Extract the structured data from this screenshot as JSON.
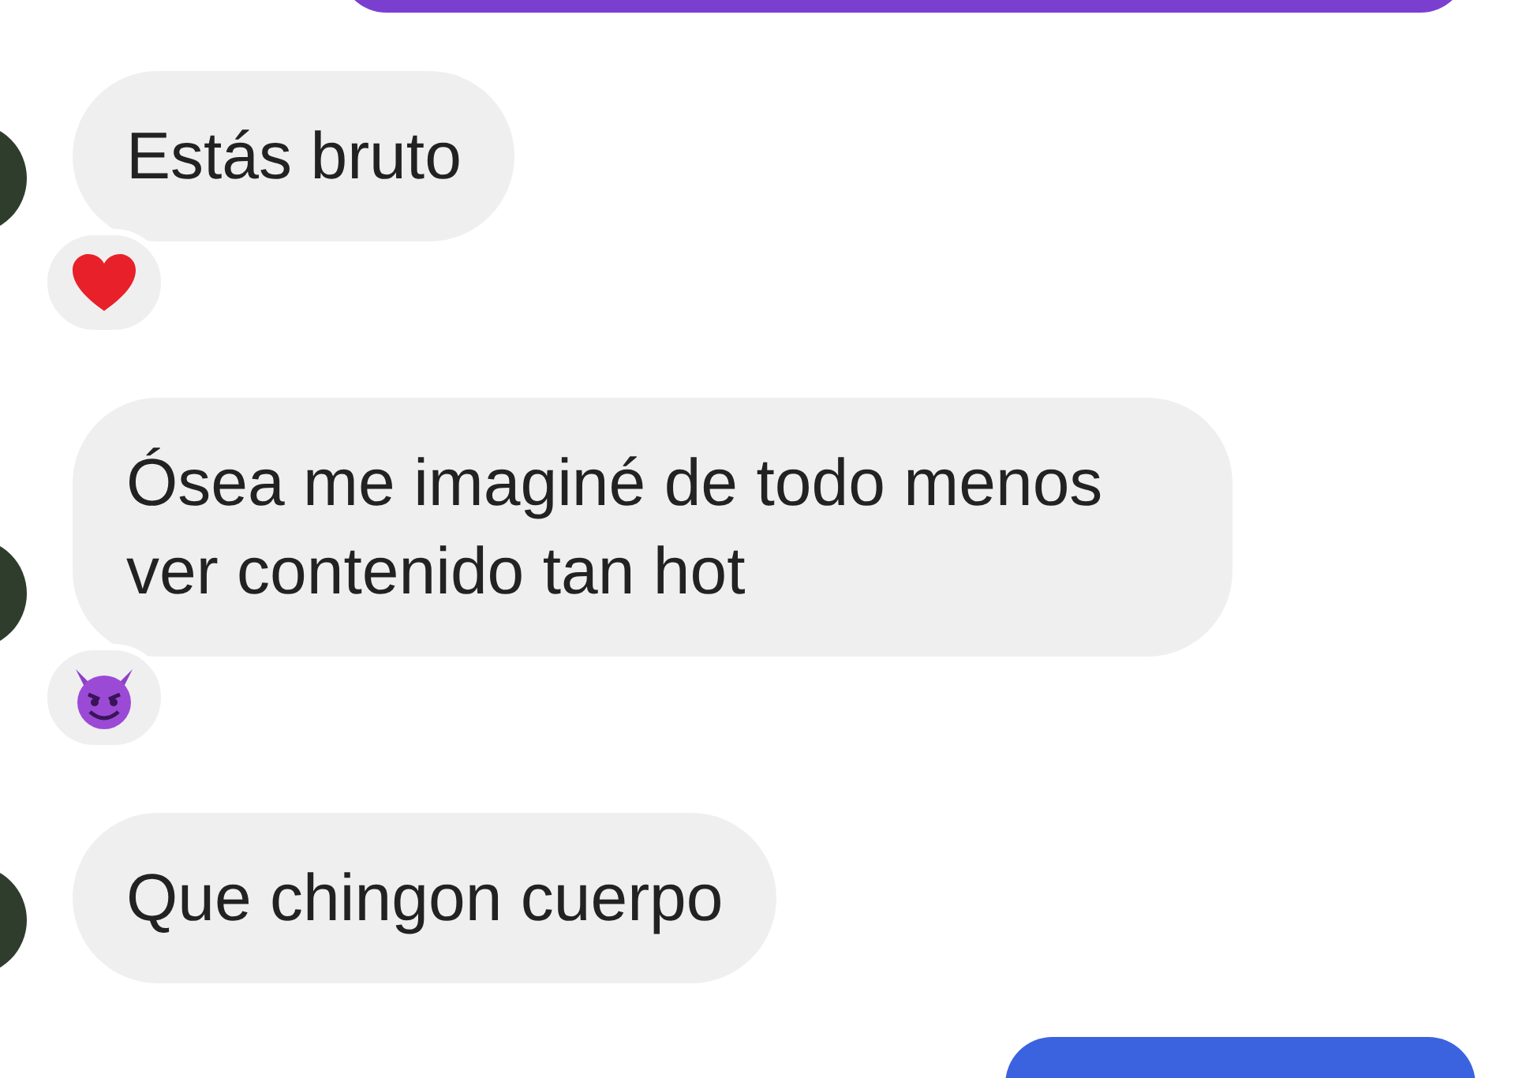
{
  "top_bubble": {
    "color": "#7b3fd0"
  },
  "messages": [
    {
      "text": "Estás bruto",
      "reaction": {
        "kind": "heart"
      }
    },
    {
      "text": "Ósea me imaginé de todo menos ver contenido tan hot",
      "reaction": {
        "kind": "devil"
      }
    },
    {
      "text": "Que chingon cuerpo"
    }
  ],
  "bottom_bubble": {
    "color": "#3b63e0"
  }
}
